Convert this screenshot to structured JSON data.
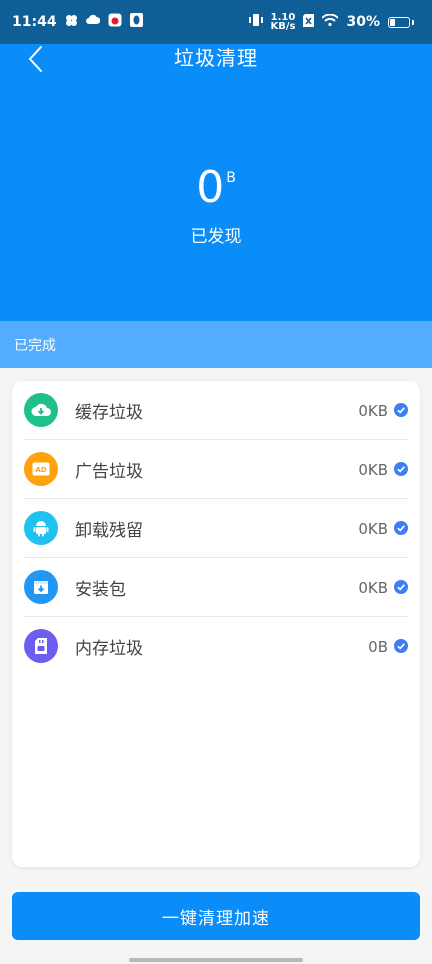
{
  "status_bar": {
    "time": "11:44",
    "net_speed_top": "1.10",
    "net_speed_bottom": "KB/s",
    "battery": "30%",
    "battery_level": 0.3
  },
  "header": {
    "title": "垃圾清理",
    "size_value": "0",
    "size_unit": "B",
    "found_label": "已发现",
    "back_icon": "chevron-left-icon"
  },
  "done_bar": {
    "label": "已完成"
  },
  "items": [
    {
      "label": "缓存垃圾",
      "size": "0KB",
      "icon": "cloud-download-icon",
      "color": "#1ec08b"
    },
    {
      "label": "广告垃圾",
      "size": "0KB",
      "icon": "ad-icon",
      "color": "#ffa20e"
    },
    {
      "label": "卸载残留",
      "size": "0KB",
      "icon": "android-icon",
      "color": "#1fc2ef"
    },
    {
      "label": "安装包",
      "size": "0KB",
      "icon": "package-icon",
      "color": "#2196f3"
    },
    {
      "label": "内存垃圾",
      "size": "0B",
      "icon": "memory-card-icon",
      "color": "#6d5ef0"
    }
  ],
  "action_button": {
    "label": "一键清理加速"
  },
  "colors": {
    "status_bar": "#0f5e96",
    "primary": "#0a8cf9",
    "done_bar": "#53acff",
    "check": "#3d7df5"
  }
}
